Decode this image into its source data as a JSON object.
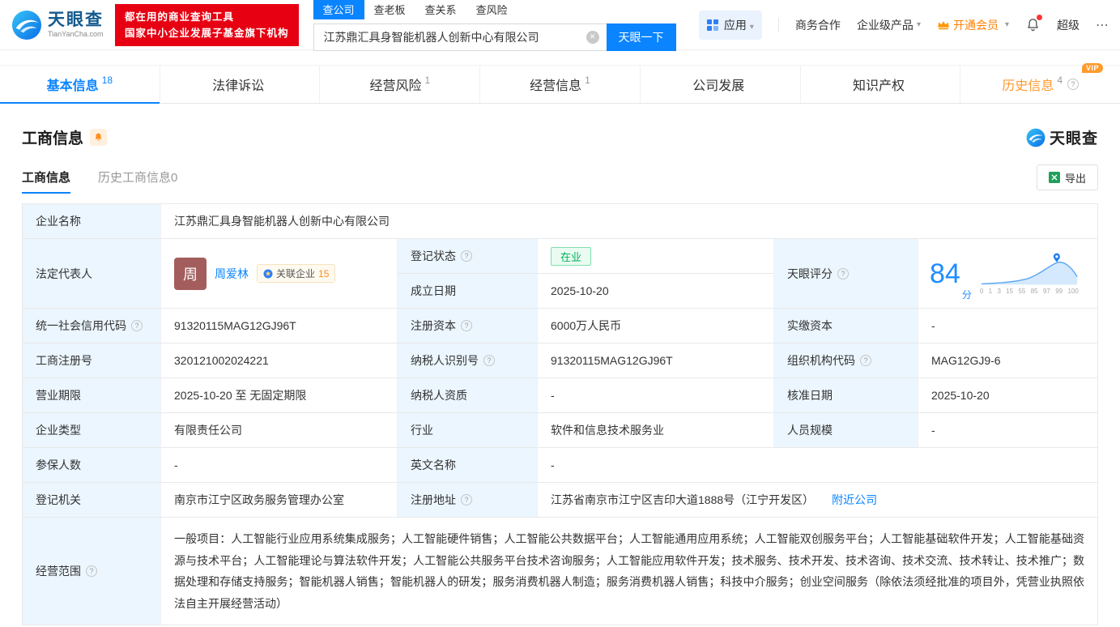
{
  "header": {
    "logo": {
      "brand": "天眼查",
      "domain": "TianYanCha.com"
    },
    "promo": {
      "line1": "都在用的商业查询工具",
      "line2": "国家中小企业发展子基金旗下机构"
    },
    "search_tabs": [
      {
        "label": "查公司"
      },
      {
        "label": "查老板"
      },
      {
        "label": "查关系"
      },
      {
        "label": "查风险"
      }
    ],
    "search": {
      "value": "江苏鼎汇具身智能机器人创新中心有限公司",
      "button": "天眼一下"
    },
    "menu": {
      "apps": "应用",
      "cooperation": "商务合作",
      "enterprise": "企业级产品",
      "vip": "开通会员",
      "super": "超级",
      "more": "⋯"
    }
  },
  "nav_tabs": [
    {
      "label": "基本信息",
      "count": "18"
    },
    {
      "label": "法律诉讼",
      "count": ""
    },
    {
      "label": "经营风险",
      "count": "1"
    },
    {
      "label": "经营信息",
      "count": "1"
    },
    {
      "label": "公司发展",
      "count": ""
    },
    {
      "label": "知识产权",
      "count": ""
    },
    {
      "label": "历史信息",
      "count": "4",
      "vip": "VIP"
    }
  ],
  "section": {
    "title": "工商信息",
    "subtab_active": "工商信息",
    "subtab_history": "历史工商信息0",
    "export": "导出",
    "brand": "天眼查"
  },
  "table": {
    "company_name": {
      "label": "企业名称",
      "value": "江苏鼎汇具身智能机器人创新中心有限公司"
    },
    "legal_rep": {
      "label": "法定代表人",
      "avatar": "周",
      "name": "周爱林",
      "related": "关联企业",
      "related_count": "15"
    },
    "reg_status": {
      "label": "登记状态",
      "value": "在业"
    },
    "establish_date": {
      "label": "成立日期",
      "value": "2025-10-20"
    },
    "score": {
      "label": "天眼评分",
      "value": "84",
      "unit": "分",
      "axis": [
        "0",
        "1",
        "3",
        "15",
        "55",
        "85",
        "97",
        "99",
        "100"
      ]
    },
    "credit_code": {
      "label": "统一社会信用代码",
      "value": "91320115MAG12GJ96T"
    },
    "reg_capital": {
      "label": "注册资本",
      "value": "6000万人民币"
    },
    "paid_capital": {
      "label": "实缴资本",
      "value": "-"
    },
    "reg_number": {
      "label": "工商注册号",
      "value": "320121002024221"
    },
    "taxpayer_id": {
      "label": "纳税人识别号",
      "value": "91320115MAG12GJ96T"
    },
    "org_code": {
      "label": "组织机构代码",
      "value": "MAG12GJ9-6"
    },
    "business_term": {
      "label": "营业期限",
      "value": "2025-10-20 至 无固定期限"
    },
    "taxpayer_quality": {
      "label": "纳税人资质",
      "value": "-"
    },
    "approval_date": {
      "label": "核准日期",
      "value": "2025-10-20"
    },
    "company_type": {
      "label": "企业类型",
      "value": "有限责任公司"
    },
    "industry": {
      "label": "行业",
      "value": "软件和信息技术服务业"
    },
    "staff_size": {
      "label": "人员规模",
      "value": "-"
    },
    "insured_count": {
      "label": "参保人数",
      "value": "-"
    },
    "english_name": {
      "label": "英文名称",
      "value": "-"
    },
    "reg_authority": {
      "label": "登记机关",
      "value": "南京市江宁区政务服务管理办公室"
    },
    "reg_address": {
      "label": "注册地址",
      "value": "江苏省南京市江宁区吉印大道1888号（江宁开发区）",
      "nearby": "附近公司"
    },
    "business_scope": {
      "label": "经营范围",
      "value": "一般项目：人工智能行业应用系统集成服务；人工智能硬件销售；人工智能公共数据平台；人工智能通用应用系统；人工智能双创服务平台；人工智能基础软件开发；人工智能基础资源与技术平台；人工智能理论与算法软件开发；人工智能公共服务平台技术咨询服务；人工智能应用软件开发；技术服务、技术开发、技术咨询、技术交流、技术转让、技术推广；数据处理和存储支持服务；智能机器人销售；智能机器人的研发；服务消费机器人制造；服务消费机器人销售；科技中介服务；创业空间服务（除依法须经批准的项目外，凭营业执照依法自主开展经营活动）"
    }
  }
}
